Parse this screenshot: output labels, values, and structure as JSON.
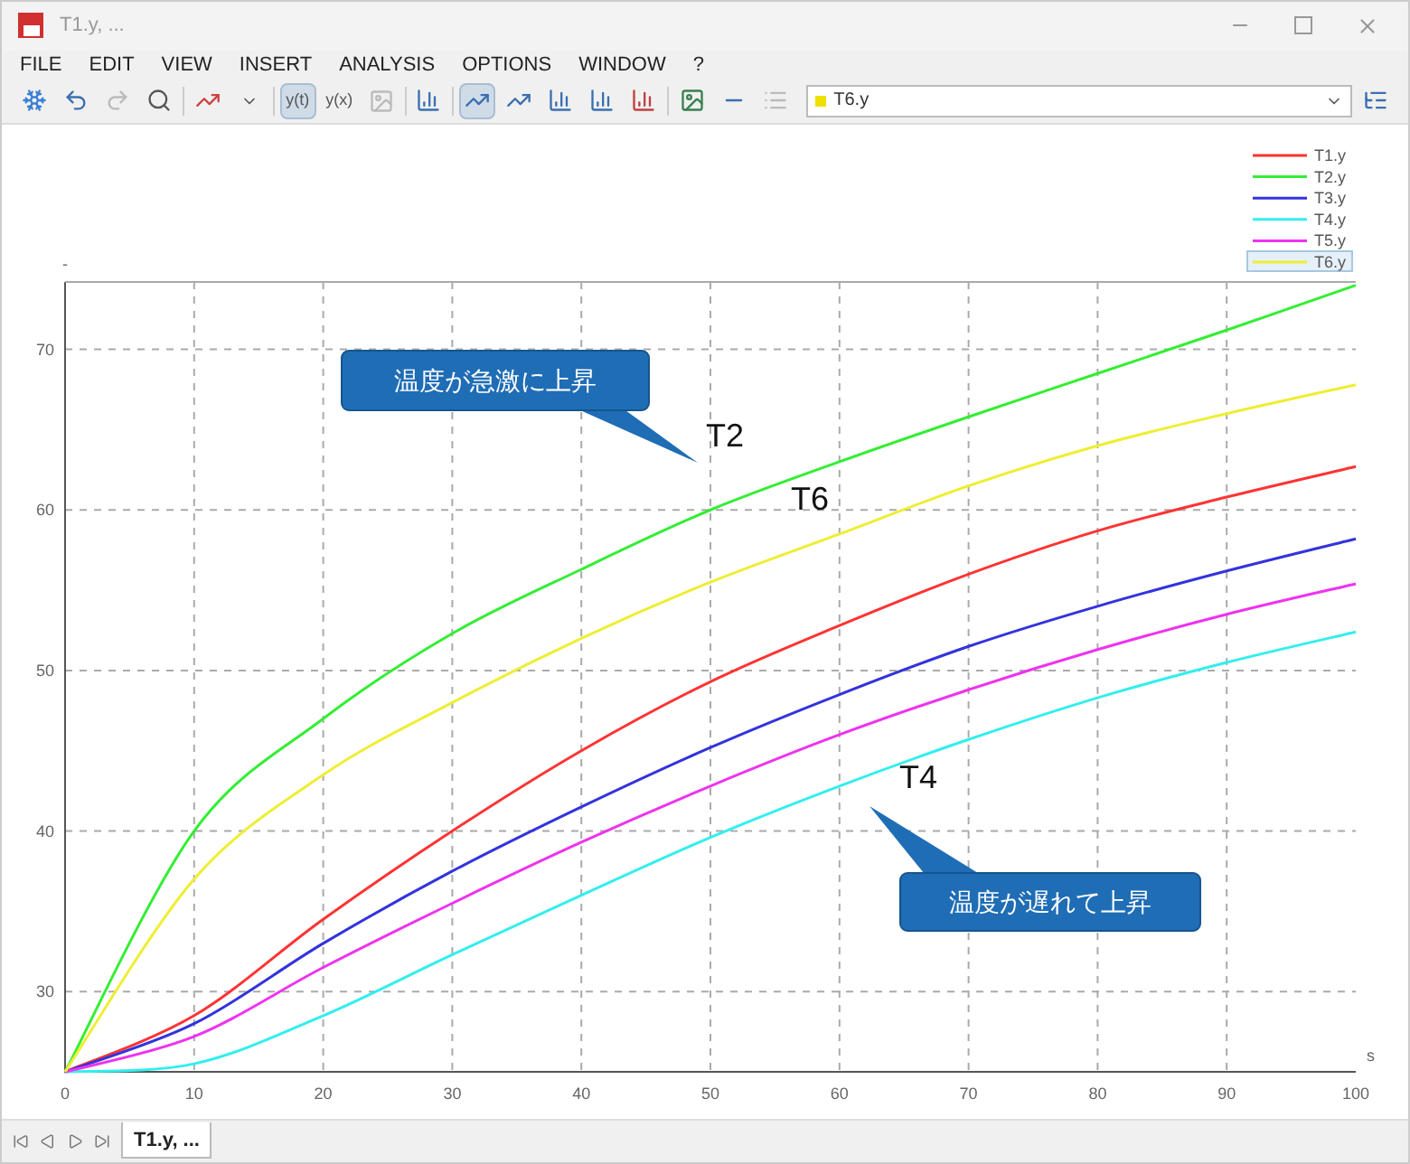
{
  "window": {
    "title": "T1.y, ..."
  },
  "menu": [
    "FILE",
    "EDIT",
    "VIEW",
    "INSERT",
    "ANALYSIS",
    "OPTIONS",
    "WINDOW",
    "?"
  ],
  "toolbar": {
    "buttons": [
      {
        "label": "y(t)",
        "selected": true
      },
      {
        "label": "y(x)",
        "selected": false
      }
    ],
    "plot_style_buttons": [
      {
        "selected": true
      },
      {
        "selected": false
      },
      {
        "selected": false
      },
      {
        "selected": false
      },
      {
        "selected": false
      }
    ],
    "variable_select": {
      "value": "T6.y",
      "color": "#f0e000"
    }
  },
  "plot": {
    "legend_items": [
      {
        "selected": false
      },
      {
        "selected": false
      },
      {
        "selected": false
      },
      {
        "selected": false
      },
      {
        "selected": false
      },
      {
        "selected": true
      }
    ],
    "chart_data": {
      "type": "line",
      "xlabel": "s",
      "ylabel": "-",
      "grid": true,
      "legend": true,
      "x": [
        0,
        10,
        20,
        30,
        40,
        50,
        60,
        70,
        80,
        90,
        100
      ],
      "xlim": [
        0,
        100
      ],
      "ylim": [
        25,
        74.2
      ],
      "xticks": [
        0,
        10,
        20,
        30,
        40,
        50,
        60,
        70,
        80,
        90,
        100
      ],
      "yticks": [
        30,
        40,
        50,
        60,
        70
      ],
      "series": [
        {
          "name": "T1.y",
          "color": "#ff3333",
          "values": [
            25,
            28.5,
            34.5,
            40,
            45,
            49.3,
            52.8,
            56,
            58.7,
            60.8,
            62.7
          ]
        },
        {
          "name": "T2.y",
          "color": "#33ee33",
          "values": [
            25,
            40,
            47,
            52.3,
            56.3,
            60,
            63,
            65.8,
            68.5,
            71.2,
            74
          ]
        },
        {
          "name": "T3.y",
          "color": "#3333dd",
          "values": [
            25,
            28,
            33,
            37.5,
            41.5,
            45.2,
            48.5,
            51.5,
            54,
            56.2,
            58.2
          ]
        },
        {
          "name": "T4.y",
          "color": "#33eeee",
          "values": [
            25,
            25.5,
            28.5,
            32.3,
            36,
            39.6,
            42.8,
            45.7,
            48.3,
            50.5,
            52.4
          ]
        },
        {
          "name": "T5.y",
          "color": "#ee33ee",
          "values": [
            25,
            27.2,
            31.5,
            35.5,
            39.3,
            42.8,
            46,
            48.8,
            51.3,
            53.5,
            55.4
          ]
        },
        {
          "name": "T6.y",
          "color": "#eeee33",
          "values": [
            25,
            37,
            43.5,
            48,
            52,
            55.5,
            58.5,
            61.5,
            64,
            66,
            67.8
          ]
        }
      ]
    },
    "annotations": [
      {
        "kind": "callout",
        "text": "温度が急激に上昇"
      },
      {
        "kind": "label",
        "text": "T2"
      },
      {
        "kind": "label",
        "text": "T6"
      },
      {
        "kind": "label",
        "text": "T4"
      },
      {
        "kind": "callout",
        "text": "温度が遅れて上昇"
      }
    ]
  },
  "tabs": [
    {
      "label": "T1.y, ...",
      "selected": true
    }
  ]
}
